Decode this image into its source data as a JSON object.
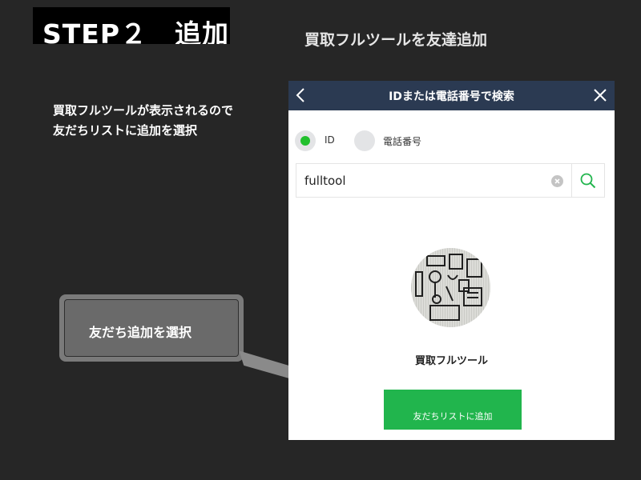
{
  "step_badge": {
    "text": "STEP２　追加"
  },
  "slide_heading": "買取フルツールを友達追加",
  "instruction": {
    "line1": "買取フルツールが表示されるので",
    "line2": "友だちリストに追加を選択"
  },
  "callout": {
    "label": "友だち追加を選択"
  },
  "phone": {
    "header": {
      "title": "IDまたは電話番号で検索",
      "back_icon": "chevron-left-icon",
      "close_icon": "close-icon"
    },
    "search_type": {
      "options": [
        {
          "label": "ID",
          "selected": true
        },
        {
          "label": "電話番号",
          "selected": false
        }
      ]
    },
    "search": {
      "value": "fulltool",
      "clear_icon": "clear-icon",
      "search_icon": "search-icon"
    },
    "result": {
      "name": "買取フルツール",
      "add_button_label": "友だちリストに追加"
    }
  },
  "colors": {
    "page_bg": "#262626",
    "header_bg": "#2b3a52",
    "line_green": "#21b54d",
    "radio_green": "#22c02d",
    "callout_bg": "#6a6a6a"
  }
}
